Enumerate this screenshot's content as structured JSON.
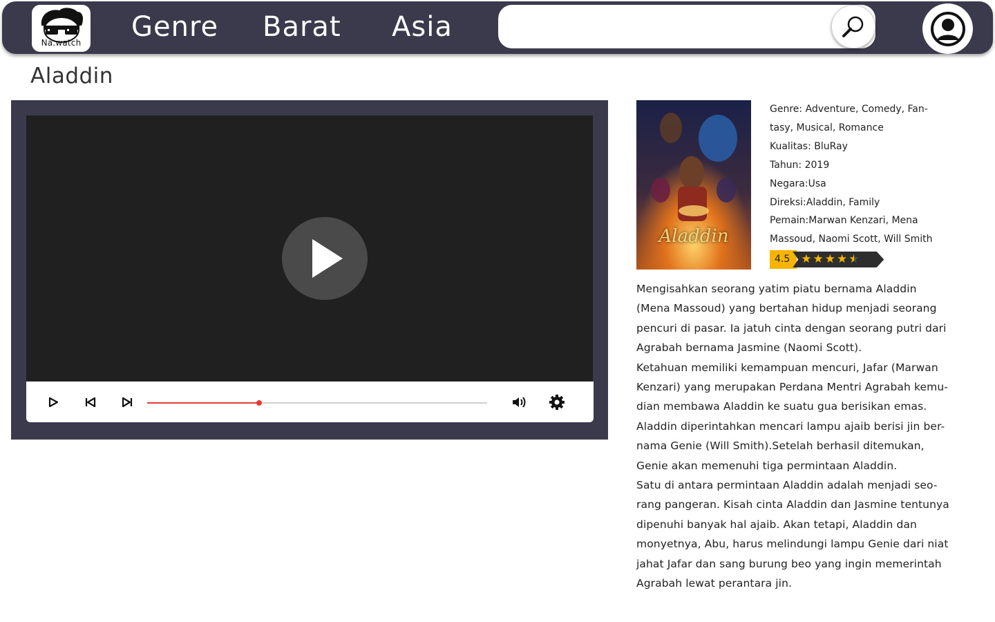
{
  "nav": {
    "logo_text": "Na.watch",
    "links": [
      "Genre",
      "Barat",
      "Asia"
    ],
    "search": {
      "value": "",
      "placeholder": ""
    }
  },
  "movie": {
    "title": "Aladdin",
    "poster_title": "Aladdin",
    "info_lines": [
      "Genre: Adventure, Comedy, Fan-",
      "tasy, Musical, Romance",
      "Kualitas: BluRay",
      "Tahun: 2019",
      "Negara:Usa",
      "Direksi:Aladdin, Family",
      "Pemain:Marwan Kenzari, Mena",
      "Massoud, Naomi Scott, Will Smith"
    ],
    "rating": {
      "score": "4.5",
      "value": 4.5,
      "max": 5
    },
    "synopsis_lines": [
      "Mengisahkan seorang yatim piatu bernama Aladdin",
      "(Mena Massoud) yang bertahan hidup menjadi seorang",
      "pencuri di pasar. Ia jatuh cinta dengan seorang putri dari",
      "Agrabah bernama Jasmine (Naomi Scott).",
      "Ketahuan memiliki kemampuan mencuri, Jafar (Marwan",
      "Kenzari) yang merupakan Perdana Mentri Agrabah kemu-",
      "dian membawa Aladdin ke suatu gua berisikan emas.",
      "Aladdin diperintahkan mencari lampu ajaib berisi jin ber-",
      "nama Genie (Will Smith).Setelah berhasil ditemukan,",
      "Genie akan memenuhi tiga permintaan Aladdin.",
      "Satu di antara permintaan Aladdin adalah menjadi seo-",
      "rang pangeran. Kisah cinta Aladdin dan Jasmine tentunya",
      "dipenuhi banyak hal ajaib. Akan tetapi, Aladdin dan",
      "monyetnya, Abu, harus melindungi lampu Genie dari niat",
      "jahat Jafar dan sang burung beo yang ingin memerintah",
      "Agrabah lewat perantara jin."
    ]
  },
  "player": {
    "progress": 0.33,
    "icons": [
      "play-icon",
      "skip-back-icon",
      "skip-forward-icon",
      "volume-icon",
      "settings-icon"
    ]
  },
  "colors": {
    "navbar": "#3b3a4c",
    "progress": "#e53935",
    "rating_badge": "#f5b400",
    "star": "#f5b400"
  }
}
